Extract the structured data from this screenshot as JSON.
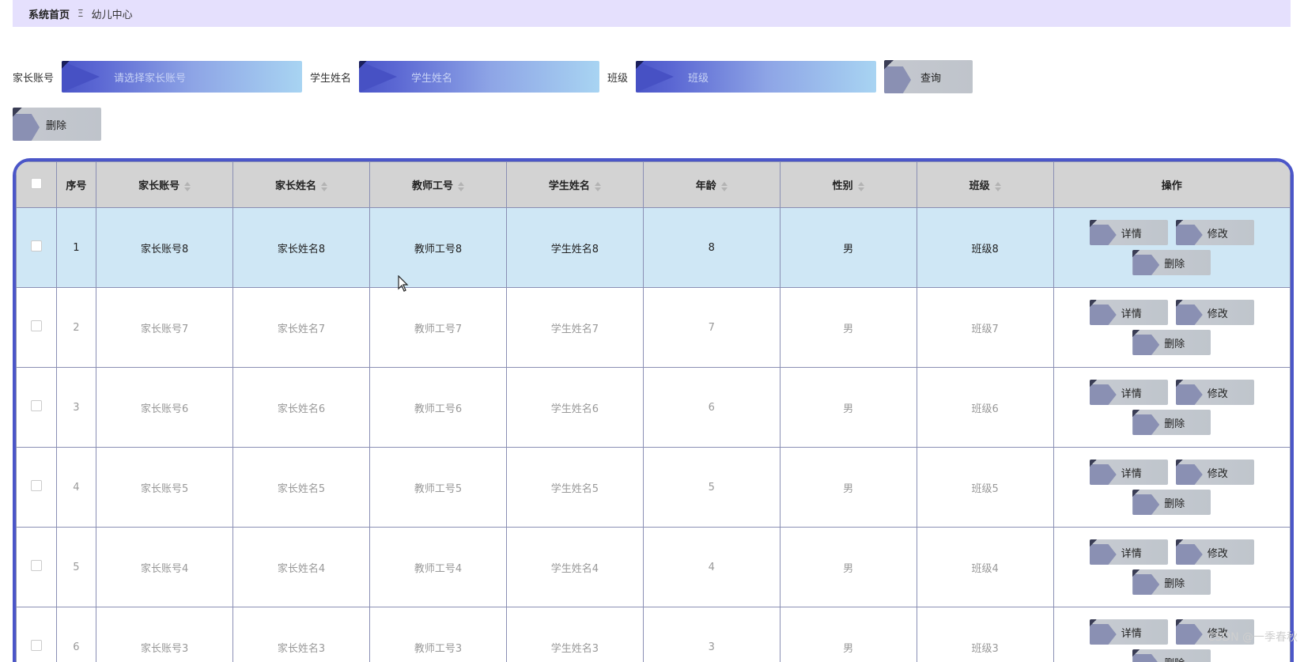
{
  "breadcrumb": {
    "home": "系统首页",
    "separator": "Ξ",
    "current": "幼儿中心"
  },
  "search": {
    "parent_account_label": "家长账号",
    "parent_account_placeholder": "请选择家长账号",
    "student_name_label": "学生姓名",
    "student_name_placeholder": "学生姓名",
    "class_label": "班级",
    "class_placeholder": "班级",
    "query_button": "查询"
  },
  "toolbar": {
    "delete_button": "删除"
  },
  "table": {
    "headers": [
      "序号",
      "家长账号",
      "家长姓名",
      "教师工号",
      "学生姓名",
      "年龄",
      "性别",
      "班级",
      "操作"
    ],
    "rows": [
      {
        "index": "1",
        "parent_account": "家长账号8",
        "parent_name": "家长姓名8",
        "teacher_id": "教师工号8",
        "student_name": "学生姓名8",
        "age": "8",
        "gender": "男",
        "class": "班级8"
      },
      {
        "index": "2",
        "parent_account": "家长账号7",
        "parent_name": "家长姓名7",
        "teacher_id": "教师工号7",
        "student_name": "学生姓名7",
        "age": "7",
        "gender": "男",
        "class": "班级7"
      },
      {
        "index": "3",
        "parent_account": "家长账号6",
        "parent_name": "家长姓名6",
        "teacher_id": "教师工号6",
        "student_name": "学生姓名6",
        "age": "6",
        "gender": "男",
        "class": "班级6"
      },
      {
        "index": "4",
        "parent_account": "家长账号5",
        "parent_name": "家长姓名5",
        "teacher_id": "教师工号5",
        "student_name": "学生姓名5",
        "age": "5",
        "gender": "男",
        "class": "班级5"
      },
      {
        "index": "5",
        "parent_account": "家长账号4",
        "parent_name": "家长姓名4",
        "teacher_id": "教师工号4",
        "student_name": "学生姓名4",
        "age": "4",
        "gender": "男",
        "class": "班级4"
      },
      {
        "index": "6",
        "parent_account": "家长账号3",
        "parent_name": "家长姓名3",
        "teacher_id": "教师工号3",
        "student_name": "学生姓名3",
        "age": "3",
        "gender": "男",
        "class": "班级3"
      }
    ],
    "row_actions": {
      "detail": "详情",
      "edit": "修改",
      "delete": "删除"
    }
  },
  "watermark": "CSDN @一季春秋",
  "colors": {
    "breadcrumb_bg": "#e5e0fd",
    "input_gradient_start": "#4b56c8",
    "input_gradient_end": "#a8d4f2",
    "table_border": "#4b56c8",
    "header_bg": "#d3d3d3",
    "selected_row_bg": "#cfe7f5",
    "button_bg": "#c5c8cf",
    "button_arrow": "#8a90b3"
  }
}
